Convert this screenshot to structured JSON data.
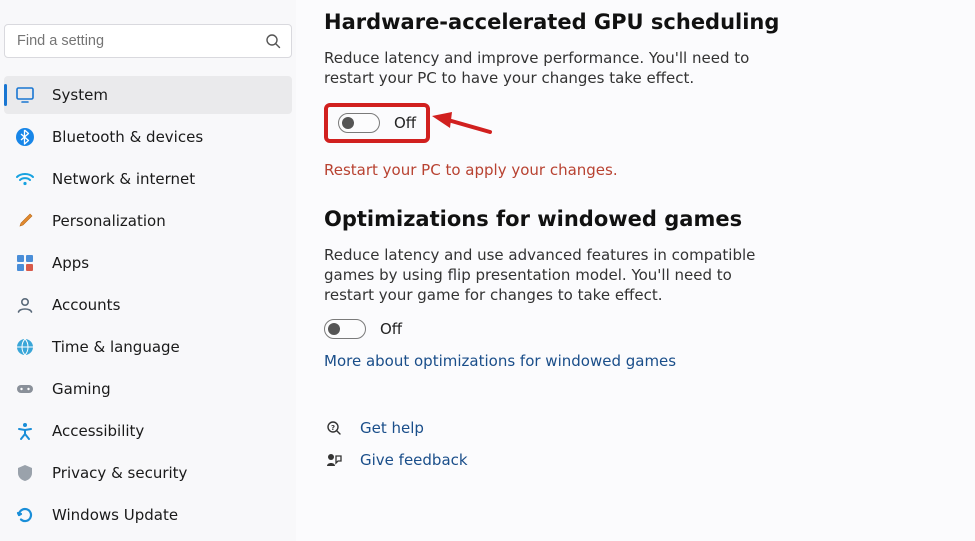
{
  "search": {
    "placeholder": "Find a setting"
  },
  "sidebar": {
    "items": [
      {
        "label": "System",
        "icon": "system"
      },
      {
        "label": "Bluetooth & devices",
        "icon": "bluetooth"
      },
      {
        "label": "Network & internet",
        "icon": "wifi"
      },
      {
        "label": "Personalization",
        "icon": "brush"
      },
      {
        "label": "Apps",
        "icon": "apps"
      },
      {
        "label": "Accounts",
        "icon": "account"
      },
      {
        "label": "Time & language",
        "icon": "clock"
      },
      {
        "label": "Gaming",
        "icon": "gamepad"
      },
      {
        "label": "Accessibility",
        "icon": "accessibility"
      },
      {
        "label": "Privacy & security",
        "icon": "shield"
      },
      {
        "label": "Windows Update",
        "icon": "update"
      }
    ],
    "selected_index": 0
  },
  "main": {
    "gpu": {
      "title": "Hardware-accelerated GPU scheduling",
      "desc": "Reduce latency and improve performance. You'll need to restart your PC to have your changes take effect.",
      "toggle_state": "Off",
      "restart_msg": "Restart your PC to apply your changes."
    },
    "wingames": {
      "title": "Optimizations for windowed games",
      "desc": "Reduce latency and use advanced features in compatible games by using flip presentation model. You'll need to restart your game for changes to take effect.",
      "toggle_state": "Off",
      "more_link": "More about optimizations for windowed games"
    },
    "help": {
      "get_help": "Get help",
      "give_feedback": "Give feedback"
    }
  }
}
